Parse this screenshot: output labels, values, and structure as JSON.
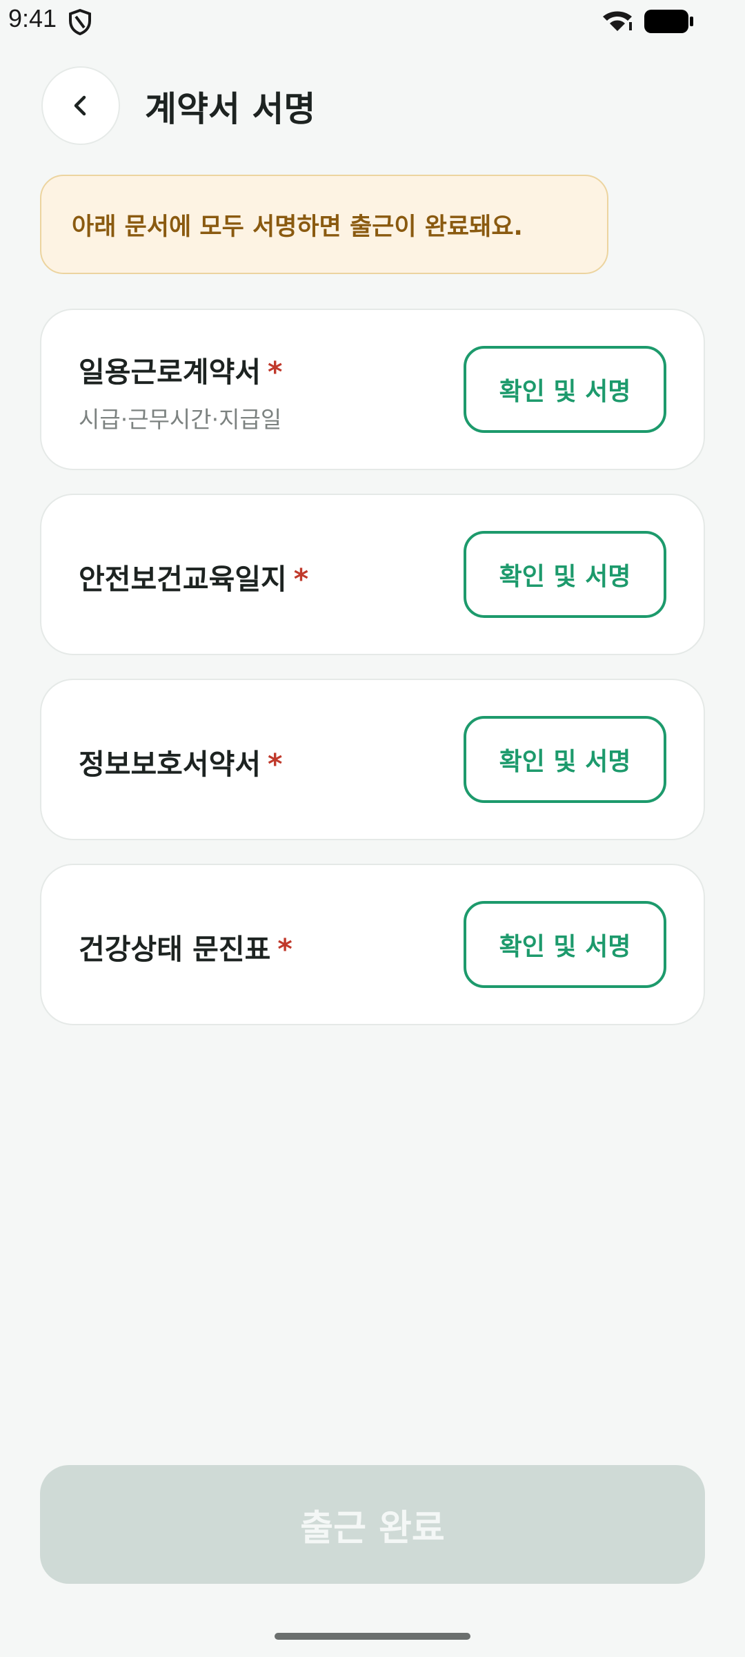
{
  "status_bar": {
    "time": "9:41",
    "icons": [
      "shield-icon",
      "wifi-icon",
      "battery-icon"
    ]
  },
  "header": {
    "back_icon": "chevron-left-icon",
    "title": "계약서 서명"
  },
  "notice": {
    "text": "아래 문서에 모두 서명하면 출근이 완료돼요."
  },
  "documents": [
    {
      "title": "일용근로계약서",
      "required_mark": "*",
      "subtitle": "시급·근무시간·지급일",
      "button_label": "확인 및 서명"
    },
    {
      "title": "안전보건교육일지",
      "required_mark": "*",
      "button_label": "확인 및 서명"
    },
    {
      "title": "정보보호서약서",
      "required_mark": "*",
      "button_label": "확인 및 서명"
    },
    {
      "title": "건강상태 문진표",
      "required_mark": "*",
      "button_label": "확인 및 서명"
    }
  ],
  "footer": {
    "complete_label": "출근 완료",
    "enabled": false
  },
  "colors": {
    "accent": "#1d9a6c",
    "required": "#c0392b",
    "notice_bg": "#fdf3e3",
    "notice_text": "#8a5a10",
    "disabled_button": "#cfdad6"
  }
}
